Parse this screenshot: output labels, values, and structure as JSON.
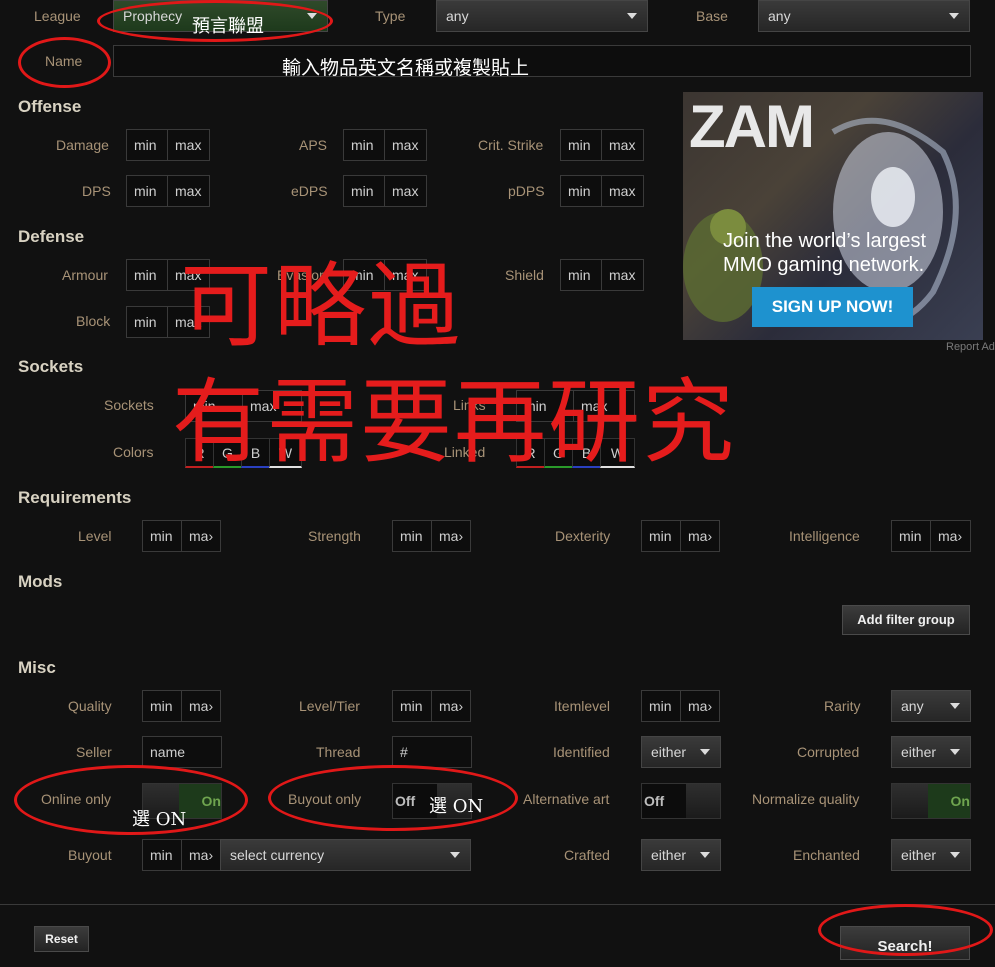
{
  "top": {
    "league_label": "League",
    "league_value": "Prophecy",
    "type_label": "Type",
    "type_value": "any",
    "base_label": "Base",
    "base_value": "any",
    "name_label": "Name"
  },
  "offense": {
    "title": "Offense",
    "damage": "Damage",
    "aps": "APS",
    "crit": "Crit. Strike",
    "dps": "DPS",
    "edps": "eDPS",
    "pdps": "pDPS"
  },
  "defense": {
    "title": "Defense",
    "armour": "Armour",
    "evasion": "Evasion",
    "shield": "Shield",
    "block": "Block"
  },
  "sockets": {
    "title": "Sockets",
    "sockets": "Sockets",
    "links": "Links",
    "colors": "Colors",
    "linked": "Linked",
    "r": "R",
    "g": "G",
    "b": "B",
    "w": "W"
  },
  "requirements": {
    "title": "Requirements",
    "level": "Level",
    "strength": "Strength",
    "dexterity": "Dexterity",
    "intelligence": "Intelligence"
  },
  "mods": {
    "title": "Mods",
    "add_filter": "Add filter group"
  },
  "misc": {
    "title": "Misc",
    "quality": "Quality",
    "level_tier": "Level/Tier",
    "itemlevel": "Itemlevel",
    "rarity": "Rarity",
    "rarity_value": "any",
    "seller": "Seller",
    "seller_value": "name",
    "thread": "Thread",
    "thread_value": "#",
    "identified": "Identified",
    "identified_value": "either",
    "corrupted": "Corrupted",
    "corrupted_value": "either",
    "online_only": "Online only",
    "buyout_only": "Buyout only",
    "alt_art": "Alternative art",
    "normalize": "Normalize quality",
    "on": "On",
    "off": "Off",
    "buyout": "Buyout",
    "currency": "select currency",
    "crafted": "Crafted",
    "crafted_value": "either",
    "enchanted": "Enchanted",
    "enchanted_value": "either"
  },
  "placeholders": {
    "min": "min",
    "max": "max",
    "max_trunc": "ma›"
  },
  "footer": {
    "reset": "Reset",
    "search": "Search!"
  },
  "ad": {
    "brand": "ZAM",
    "line1": "Join the world’s largest",
    "line2": "MMO gaming network.",
    "cta": "SIGN UP NOW!",
    "report": "Report Ad"
  },
  "annotations": {
    "league_note": "預言聯盟",
    "name_note": "輸入物品英文名稱或複製貼上",
    "skip_line1": "可略過",
    "skip_line2": "有需要再研究",
    "online_note": "選 ON",
    "buyout_note": "選 ON"
  }
}
